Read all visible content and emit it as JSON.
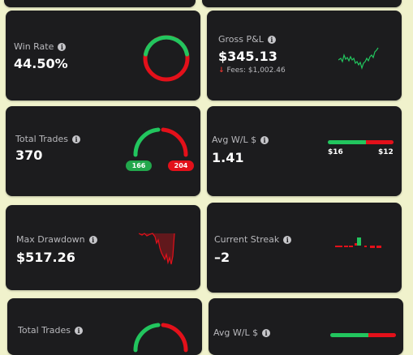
{
  "colors": {
    "green": "#22c55e",
    "red": "#e3101a",
    "card": "#1c1c1e",
    "bg": "#f0f2cc"
  },
  "win_rate": {
    "label": "Win Rate",
    "value": "44.50%",
    "win_fraction": 0.445
  },
  "gross_pnl": {
    "label": "Gross P&L",
    "value": "$345.13",
    "fees": "Fees: $1,002.46",
    "icon": "arrow-down-icon"
  },
  "total_trades": {
    "label": "Total Trades",
    "value": "370",
    "wins": "166",
    "losses": "204"
  },
  "avg_wl": {
    "label": "Avg W/L $",
    "value": "1.41",
    "avg_win": "$16",
    "avg_loss": "$12",
    "win_fraction": 0.58
  },
  "max_drawdown": {
    "label": "Max Drawdown",
    "value": "$517.26"
  },
  "current_streak": {
    "label": "Current Streak",
    "value": "–2"
  },
  "total_trades_2": {
    "label": "Total Trades"
  },
  "avg_wl_2": {
    "label": "Avg W/L $"
  }
}
